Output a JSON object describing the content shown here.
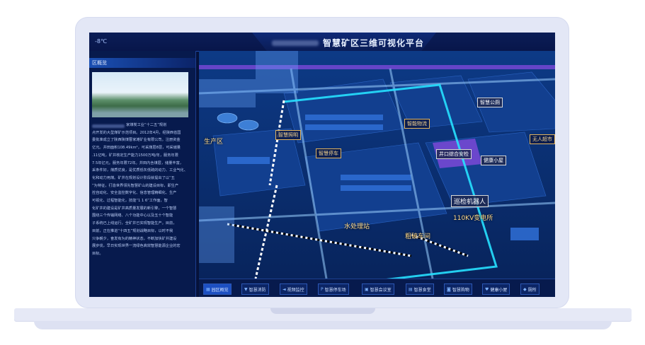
{
  "header": {
    "temperature": "-8℃",
    "title": "智慧矿区三维可视化平台"
  },
  "left_panel": {
    "section_title": "区概览",
    "description_lines": [
      "家煤炭工业“十二五”规划",
      "点开发的大型煤矿示范项目。2012年4月，经陕西省国",
      "委批准成立了陕西陕煤曹家滩矿业有限公司。注册资金",
      "亿元。井田面积108.49km²，可采煤层8层，可采储量",
      ".11亿吨，矿井核定生产能力1500万吨/年，服务年限",
      "7.5年亿元。服务年限72年。井田内含煤层，储量丰富，",
      "采条件好，煤质优良，是优质低灰低硫的动力、工业气化、",
      "化和动力用煤。矿井在规划设计阶段就提出了以“五",
      "”为特征，打造世界领先智慧矿山的建设目标，即生产",
      "控自动化、安全监控数字化、信息管理精细化、生产",
      "可视化、过程智能化，技能“1 1 6”工作面，智",
      "化矿井的建设是矿井高质量发展的新引擎，一个智慧",
      "围绕三个传输网络、八个功能中心以及五十个智能",
      "子系统已上线运行，全矿井已实现智能生产。目前，",
      "目前，正在推进“十四五”规划战略目标，以时不我",
      "只争朝夕，奋发有为的精神状态，不断加快矿井建设",
      "展步伐，早日实现世界一流绿色高效智慧能源企业的宏",
      "目标。"
    ]
  },
  "map": {
    "labels": [
      {
        "id": "production-area",
        "text": "生产区"
      },
      {
        "id": "smart-lighting",
        "text": "智慧照明"
      },
      {
        "id": "smart-parking",
        "text": "智慧停车"
      },
      {
        "id": "smart-property",
        "text": "智能物流"
      },
      {
        "id": "smart-restroom",
        "text": "智慧公厕"
      },
      {
        "id": "unmanned-supermarket",
        "text": "无人超市"
      },
      {
        "id": "wellhead-security",
        "text": "井口综合安检"
      },
      {
        "id": "health-cabin",
        "text": "健康小屋"
      },
      {
        "id": "patrol-robot",
        "text": "巡检机器人"
      },
      {
        "id": "water-station",
        "text": "水处理站"
      },
      {
        "id": "substation",
        "text": "110KV变电所"
      },
      {
        "id": "crushing-workshop",
        "text": "粗破车间"
      }
    ]
  },
  "bottom_nav": {
    "items": [
      {
        "label": "园区概览",
        "icon": "grid-icon",
        "active": true
      },
      {
        "label": "智慧消防",
        "icon": "fire-icon",
        "active": false
      },
      {
        "label": "视频监控",
        "icon": "camera-icon",
        "active": false
      },
      {
        "label": "智慧停车场",
        "icon": "parking-icon",
        "active": false
      },
      {
        "label": "智慧会议室",
        "icon": "meeting-icon",
        "active": false
      },
      {
        "label": "智慧食堂",
        "icon": "canteen-icon",
        "active": false
      },
      {
        "label": "智慧购物",
        "icon": "cart-icon",
        "active": false
      },
      {
        "label": "健康小屋",
        "icon": "heart-icon",
        "active": false
      },
      {
        "label": "厕所",
        "icon": "restroom-icon",
        "active": false
      }
    ]
  },
  "colors": {
    "background": "#06123a",
    "accent": "#2c8cff",
    "label_border": "#e3b45d",
    "road_highlight": "#27e1ff"
  }
}
